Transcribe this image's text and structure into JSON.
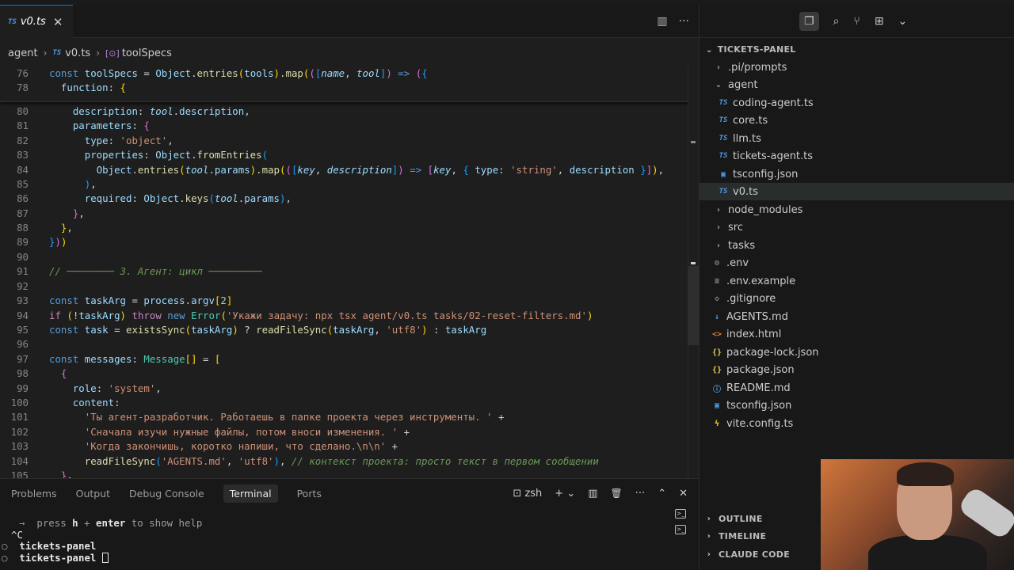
{
  "editor": {
    "tab": {
      "lang": "TS",
      "title": "v0.ts",
      "close": "✕"
    },
    "breadcrumb": {
      "folder": "agent",
      "lang": "TS",
      "file": "v0.ts",
      "symbol_glyph": "[⊙]",
      "symbol": "toolSpecs"
    },
    "actions": {
      "split": "▥",
      "more": "···"
    }
  },
  "code": {
    "line_numbers": [
      "76",
      "78",
      "80",
      "81",
      "82",
      "83",
      "84",
      "85",
      "86",
      "87",
      "88",
      "89",
      "90",
      "91",
      "92",
      "93",
      "94",
      "95",
      "96",
      "97",
      "98",
      "99",
      "100",
      "101",
      "102",
      "103",
      "104",
      "105"
    ]
  },
  "panel": {
    "tabs": [
      "Problems",
      "Output",
      "Debug Console",
      "Terminal",
      "Ports"
    ],
    "active_tab": "Terminal",
    "shell": "zsh",
    "actions": {
      "new": "+",
      "chevron": "⌄",
      "split": "▥",
      "trash": "🗑",
      "more": "···",
      "up": "⌃",
      "close": "✕"
    },
    "terminal": {
      "line1_arrow": "→",
      "line1_press": "press",
      "line1_h": "h",
      "line1_plus": "+",
      "line1_enter": "enter",
      "line1_rest": "to show help",
      "line2": "^C",
      "line3_prompt": "○",
      "line3_dir": "tickets-panel",
      "line4_prompt": "○",
      "line4_dir": "tickets-panel"
    }
  },
  "explorer": {
    "header": "TICKETS-PANEL",
    "items": [
      {
        "label": ".pi/prompts",
        "type": "folder",
        "depth": 0
      },
      {
        "label": "agent",
        "type": "folder-open",
        "depth": 0
      },
      {
        "label": "coding-agent.ts",
        "type": "ts",
        "depth": 1
      },
      {
        "label": "core.ts",
        "type": "ts",
        "depth": 1
      },
      {
        "label": "llm.ts",
        "type": "ts",
        "depth": 1
      },
      {
        "label": "tickets-agent.ts",
        "type": "ts",
        "depth": 1
      },
      {
        "label": "tsconfig.json",
        "type": "tsconfig",
        "depth": 1
      },
      {
        "label": "v0.ts",
        "type": "ts",
        "depth": 1
      },
      {
        "label": "node_modules",
        "type": "folder",
        "depth": 0
      },
      {
        "label": "src",
        "type": "folder",
        "depth": 0
      },
      {
        "label": "tasks",
        "type": "folder",
        "depth": 0
      },
      {
        "label": ".env",
        "type": "gear",
        "depth": 0
      },
      {
        "label": ".env.example",
        "type": "lines",
        "depth": 0
      },
      {
        "label": ".gitignore",
        "type": "git",
        "depth": 0
      },
      {
        "label": "AGENTS.md",
        "type": "md",
        "depth": 0
      },
      {
        "label": "index.html",
        "type": "html",
        "depth": 0
      },
      {
        "label": "package-lock.json",
        "type": "json",
        "depth": 0
      },
      {
        "label": "package.json",
        "type": "json",
        "depth": 0
      },
      {
        "label": "README.md",
        "type": "info",
        "depth": 0
      },
      {
        "label": "tsconfig.json",
        "type": "tsconfig",
        "depth": 0
      },
      {
        "label": "vite.config.ts",
        "type": "vite",
        "depth": 0
      }
    ],
    "selected": "v0.ts",
    "sections": [
      "OUTLINE",
      "TIMELINE",
      "CLAUDE CODE"
    ]
  },
  "colors": {
    "accent": "#0078d4",
    "keyword": "#569cd6",
    "string": "#ce9178",
    "comment": "#6a9955",
    "function": "#dcdcaa"
  }
}
